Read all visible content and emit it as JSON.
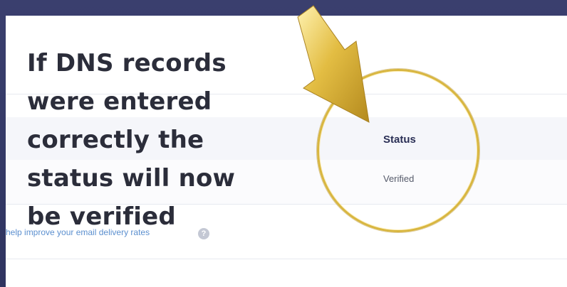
{
  "caption": {
    "lines": [
      "If DNS records",
      "were entered",
      "correctly the",
      "status will now",
      "be verified"
    ]
  },
  "table": {
    "status_header": "Status",
    "status_value": "Verified"
  },
  "help": {
    "text": "help improve your email delivery rates",
    "icon_glyph": "?"
  },
  "colors": {
    "highlight": "#d8b640",
    "header": "#2a2f55",
    "link": "#5b8fcf"
  }
}
